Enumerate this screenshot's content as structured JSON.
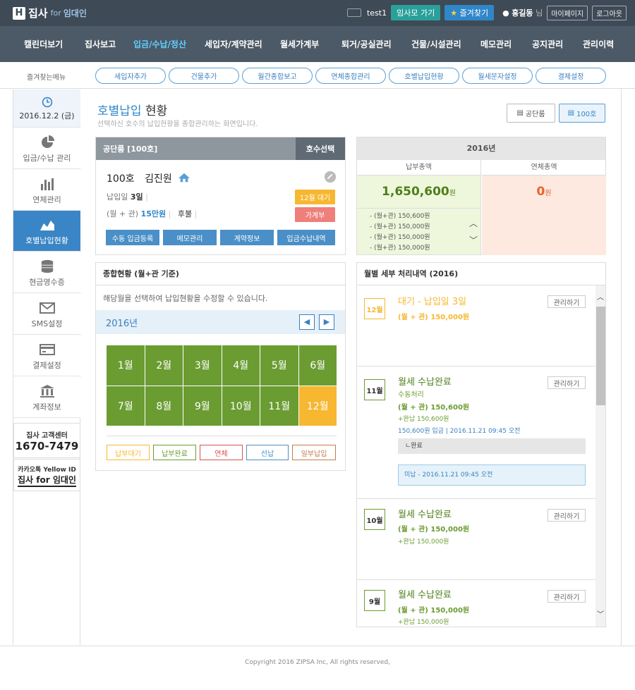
{
  "topbar": {
    "brand": "집사",
    "brand_for": "for",
    "brand_sub": "임대인",
    "account": "test1",
    "btn_go": "임사모 가기",
    "btn_fav": "즐겨찾기",
    "username": "홍길동",
    "honorific": "님",
    "mypage": "마이페이지",
    "logout": "로그아웃"
  },
  "nav": [
    "캘린더보기",
    "집사보고",
    "입금/수납/정산",
    "세입자/계약관리",
    "월세가계부",
    "퇴거/공실관리",
    "건물/시설관리",
    "메모관리",
    "공지관리",
    "관리이력"
  ],
  "fav": {
    "label": "즐겨찾는메뉴",
    "items": [
      "세입자추가",
      "건물추가",
      "월간종합보고",
      "연체종합관리",
      "호별납입현황",
      "월세문자설정",
      "결제설정"
    ]
  },
  "sidebar": {
    "date": "2016.12.2 (금)",
    "items": [
      "입금/수납 관리",
      "연체관리",
      "호별납입현황",
      "현금영수증",
      "SMS설정",
      "결제설정",
      "계좌정보"
    ],
    "cs_title": "집사 고객센터",
    "cs_phone": "1670-7479",
    "kakao": "카카오톡 Yellow ID",
    "kakao_name": "집사 for 임대인"
  },
  "page": {
    "title_blue": "호별납입",
    "title_dark": "현황",
    "subtitle": "선택하신 호수의 납입현황을 종합관리하는 화면입니다.",
    "tab_building": "공단룸",
    "tab_unit": "100호"
  },
  "unit": {
    "header": "공단룸 [100호]",
    "select": "호수선택",
    "room": "100호",
    "tenant": "김진원",
    "pay_day_label": "납입일",
    "pay_day": "3일",
    "rent_label": "(월 + 관)",
    "rent": "15만원",
    "rent_type": "후불",
    "tag_wait": "12월 대기",
    "tag_book": "가계부",
    "btns": [
      "수동 입금등록",
      "메모관리",
      "계약정보",
      "입금수납내역"
    ]
  },
  "summary": {
    "year": "2016년",
    "paid_label": "납부총액",
    "overdue_label": "연체총액",
    "paid_amount": "1,650,600",
    "overdue_amount": "0",
    "won": "원",
    "list": [
      "- (월+관) 150,600원",
      "- (월+관) 150,000원",
      "- (월+관) 150,000원",
      "- (월+관) 150,000원"
    ]
  },
  "overall": {
    "header": "종합현황 (월+관 기준)",
    "hint": "해당월을 선택하여 납입현황을 수정할 수 있습니다.",
    "year": "2016년",
    "months": [
      "1월",
      "2월",
      "3월",
      "4월",
      "5월",
      "6월",
      "7월",
      "8월",
      "9월",
      "10월",
      "11월",
      "12월"
    ],
    "current_month_index": 11,
    "legend": [
      "납부대기",
      "납부완료",
      "연체",
      "선납",
      "일부납입"
    ],
    "legend_colors": [
      "#f7b731",
      "#6b9c32",
      "#d9534f",
      "#4a8fc7",
      "#c87a4a"
    ]
  },
  "history": {
    "header": "월별 세부 처리내역 (2016)",
    "manage": "관리하기",
    "rows": [
      {
        "month": "12월",
        "title": "대기 - 납입일 3일",
        "line1": "(월 + 관) 150,000원",
        "line2": "",
        "line3": "",
        "extra": "",
        "note": ""
      },
      {
        "month": "11월",
        "title": "월세 수납완료",
        "line1": "수동처리",
        "line2": "(월 + 관) 150,600원",
        "line3": "+완납 150,600원",
        "extra": "150,600원 입금 | 2016.11.21 09:45 오전",
        "done": "ㄴ완료",
        "note": "미납 - 2016.11.21 09:45 오전"
      },
      {
        "month": "10월",
        "title": "월세 수납완료",
        "line1": "(월 + 관) 150,000원",
        "line2": "+완납 150,000원",
        "line3": "",
        "extra": "",
        "note": ""
      },
      {
        "month": "9월",
        "title": "월세 수납완료",
        "line1": "(월 + 관) 150,000원",
        "line2": "+완납 150,000원",
        "line3": "",
        "extra": "",
        "note": ""
      }
    ]
  },
  "footer": "Copyright 2016 ZIPSA Inc, All rights reserved,"
}
